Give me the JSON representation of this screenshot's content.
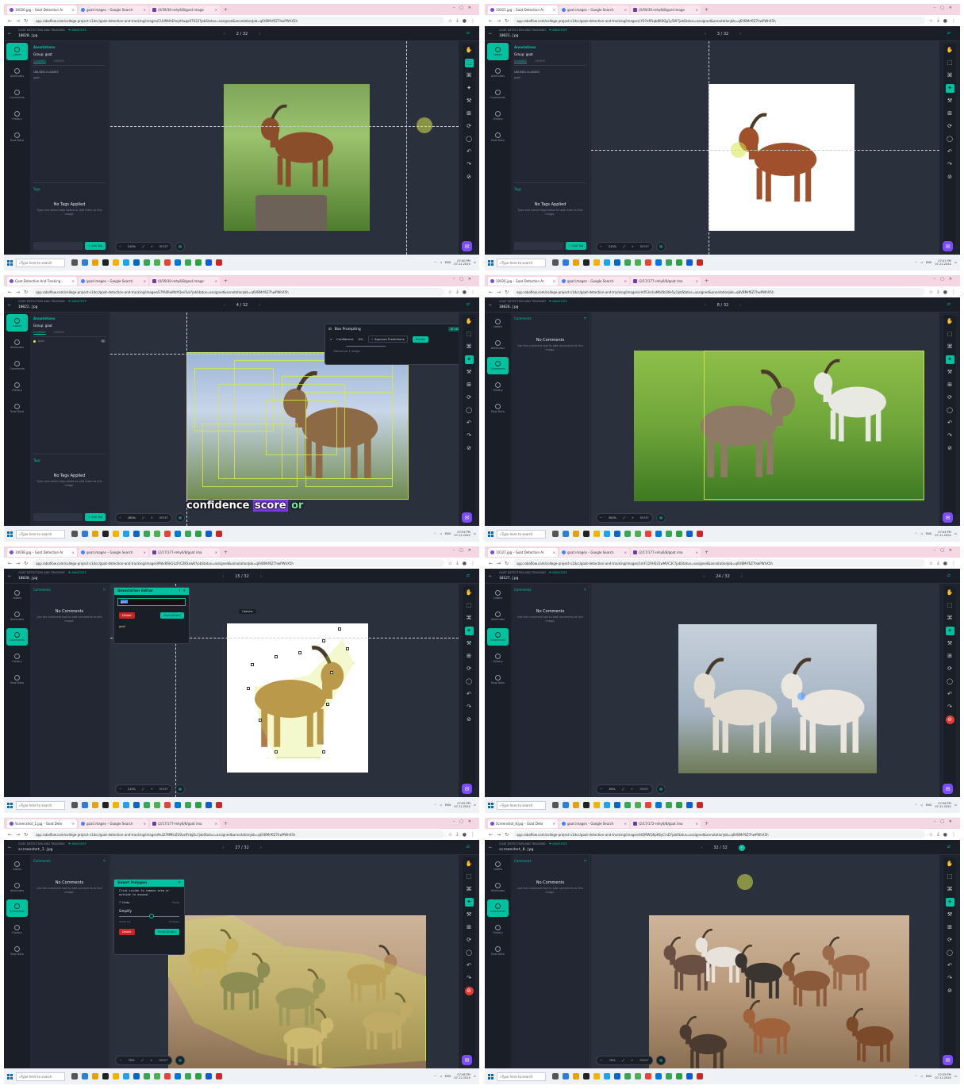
{
  "shots": [
    {
      "tabs": [
        "10020.jpg – Goat Detection Ar",
        "goat images – Google Search",
        "(0/59/30-rehy6/8/goat image"
      ],
      "url": "app.roboflow.com/college-project-s1dcc/goat-detection-and-tracking/images/CUUMHhEhejrHwqo07633?jobStatus=assigned&annotationJob=q6VBMrf6Z7hwPWhX5h",
      "crumb": "GOAT DETECTION AND TRACKING",
      "annotate": "ANNOTATE",
      "file": "10020.jpg",
      "pager": "2 / 32",
      "panel": "labels",
      "zoom": "210%",
      "clock_time": "07:00 PM",
      "clock_date": "07-11-2024"
    },
    {
      "tabs": [
        "10021.jpg – Goat Detection Ar",
        "goat images – Google Search",
        "(0/59/30-rehy6/8/goat image"
      ],
      "url": "app.roboflow.com/college-project-s1dcc/goat-detection-and-tracking/images/cY07eM1qb8K0Qg1y5W7jobStatus=assigned&annotationJob=q6VBMrf6Z7hwPWhX5h",
      "crumb": "GOAT DETECTION AND TRACKING",
      "annotate": "ANNOTATE",
      "file": "10021.jpg",
      "pager": "3 / 32",
      "panel": "labels",
      "zoom": "210%",
      "clock_time": "07:01 PM",
      "clock_date": "07-11-2024"
    },
    {
      "tabs": [
        "Goat Detection And Tracking –",
        "goat images – Google Search",
        "(0/59/30-rehy6/8/goat image"
      ],
      "url": "app.roboflow.com/college-project-s1dcc/goat-detection-and-tracking/images/S7fA0RwMzYQeeTuk?jobStatus=assigned&annotationJob=q6VBMrf6Z7hwPWhX5h",
      "crumb": "GOAT DETECTION AND TRACKING",
      "annotate": "ANNOTATE",
      "file": "10022.jpg",
      "pager": "4 / 32",
      "panel": "labels",
      "zoom": "260%",
      "clock_time": "07:03 PM",
      "clock_date": "07-11-2024"
    },
    {
      "tabs": [
        "10026.jpg – Goat Detection Ar",
        "goat images – Google Search",
        "(2/17/177-rehy6/8/goat ima"
      ],
      "url": "app.roboflow.com/college-project-s1dcc/goat-detection-and-tracking/images/vmf53vUiaMbObO0e5y?jobStatus=assigned&annotationJob=q6VBMrf6Z7hwPWhX5h",
      "crumb": "GOAT DETECTION AND TRACKING",
      "annotate": "ANNOTATE",
      "file": "10026.jpg",
      "pager": "8 / 32",
      "panel": "comments",
      "zoom": "300%",
      "clock_time": "07:04 PM",
      "clock_date": "07-11-2024"
    },
    {
      "tabs": [
        "10038.jpg – Goat Detection Ar",
        "goat images – Google Search",
        "(2/17/177-rehy6/8/goat ima"
      ],
      "url": "app.roboflow.com/college-project-s1dcc/goat-detection-and-tracking/images/MdxR6kG1zFtCZKSnwK?jobStatus=assigned&annotationJob=q6VBMrf6Z7hwPWhX5h",
      "crumb": "GOAT DETECTION AND TRACKING",
      "annotate": "ANNOTATE",
      "file": "10038.jpg",
      "pager": "15 / 32",
      "panel": "comments",
      "zoom": "210%",
      "clock_time": "07:05 PM",
      "clock_date": "07-11-2024"
    },
    {
      "tabs": [
        "10127.jpg – Goat Detection Ar",
        "goat images – Google Search",
        "(2/17/177-rehy6/8/goat ima"
      ],
      "url": "app.roboflow.com/college-project-s1dcc/goat-detection-and-tracking/images/1mF12XHS31wMVC3C?jobStatus=assigned&annotationJob=q6VBMrf6Z7hwPWhX5h",
      "crumb": "GOAT DETECTION AND TRACKING",
      "annotate": "ANNOTATE",
      "file": "10127.jpg",
      "pager": "24 / 32",
      "panel": "comments",
      "zoom": "80%",
      "clock_time": "07:06 PM",
      "clock_date": "07-11-2024"
    },
    {
      "tabs": [
        "Screenshot_1.jpg – Goat Dete",
        "goat images – Google Search",
        "(2/17/177-rehy6/8/goat ima"
      ],
      "url": "app.roboflow.com/college-project-s1dcc/goat-detection-and-tracking/images/HuD7MMkIZU0oxlFrdgSu?jobStatus=assigned&annotationJob=q6VBMrf6Z7hwPWhX5h",
      "crumb": "GOAT DETECTION AND TRACKING",
      "annotate": "ANNOTATE",
      "file": "screenshot_1.jpg",
      "pager": "27 / 32",
      "panel": "comments",
      "zoom": "70%",
      "clock_time": "07:08 PM",
      "clock_date": "07-11-2024"
    },
    {
      "tabs": [
        "Screenshot_8.jpg – Goat Dete",
        "goat images – Google Search",
        "(2/17/172-rehy6/8/goat ima"
      ],
      "url": "app.roboflow.com/college-project-s1dcc/goat-detection-and-tracking/images/4lQMWQ6pK6yCrsD?jobStatus=assigned&annotationJob=q6VBMrf6Z7hwPWhX5h",
      "crumb": "GOAT DETECTION AND TRACKING",
      "annotate": "ANNOTATE",
      "file": "screenshot_8.jpg",
      "pager": "32 / 32",
      "panel": "comments",
      "zoom": "70%",
      "clock_time": "07:09 PM",
      "clock_date": "07-11-2024"
    }
  ],
  "rail": [
    "Labels",
    "Attributes",
    "Comments",
    "History",
    "Raw Data"
  ],
  "labels_panel": {
    "title": "Annotations",
    "group": "Group: goat",
    "tab_classes": "CLASSES",
    "tab_layers": "LAYERS",
    "unused": "UNUSED CLASSES",
    "class_name": "goat",
    "class_count": "1",
    "tags_title": "Tags",
    "no_tags": "No Tags Applied",
    "no_tags_sub": "Type and select tags below to add them to this image.",
    "add_tag": "+ Add Tag"
  },
  "comments_panel": {
    "title": "Comments",
    "none": "No Comments",
    "sub": "Use the comment tool to add comments to this image."
  },
  "zoom_reset": "RESET",
  "box_prompting": {
    "title": "Box Prompting",
    "ai_labeling": "AI Labeling",
    "confidence_label": "Confidence",
    "confidence_value": "0%",
    "approve": "Approve Predictions",
    "predict": "Predict",
    "trained": "Trained on 1 image",
    "auto_run": "Auto run"
  },
  "caption": {
    "w1": "confidence",
    "w2": "score",
    "w3": "or"
  },
  "annotation_editor": {
    "title": "Annotation Editor",
    "input": "goat",
    "delete": "Delete",
    "save": "Save (Enter)",
    "class": "goat",
    "options": "Options",
    "saving": "Saving"
  },
  "smart_polygon": {
    "title": "Smart Polygon",
    "hint": "Click inside to remove area or outside to expand.",
    "undo": "Undo",
    "redo": "Redo",
    "simplify": "Simplify",
    "complex": "Complex",
    "less": "Comp Lss",
    "delete": "Delete",
    "finish": "Finish (Enter)"
  },
  "taskbar": {
    "search": "Type here to search",
    "lang": "ENG"
  },
  "colors": {
    "accent": "#00c2a0",
    "annotation": "#d6e84a",
    "chat": "#7c4dff"
  }
}
